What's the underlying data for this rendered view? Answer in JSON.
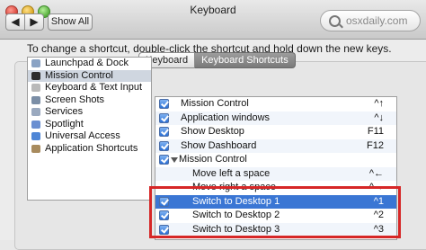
{
  "window": {
    "title": "Keyboard",
    "nav_back": "◀",
    "nav_forward": "▶",
    "show_all": "Show All",
    "watermark": "osxdaily.com"
  },
  "tabs": [
    {
      "label": "Keyboard",
      "selected": false
    },
    {
      "label": "Keyboard Shortcuts",
      "selected": true
    }
  ],
  "instructions": "To change a shortcut, double-click the shortcut and hold down the new keys.",
  "categories": [
    {
      "label": "Launchpad & Dock",
      "icon": "launchpad-icon",
      "color": "#8aa3c4"
    },
    {
      "label": "Mission Control",
      "icon": "mission-control-icon",
      "color": "#2d2d2d",
      "selected": true
    },
    {
      "label": "Keyboard & Text Input",
      "icon": "keyboard-icon",
      "color": "#b9b9b9"
    },
    {
      "label": "Screen Shots",
      "icon": "camera-icon",
      "color": "#7b8ea6"
    },
    {
      "label": "Services",
      "icon": "gear-icon",
      "color": "#9aa9bf"
    },
    {
      "label": "Spotlight",
      "icon": "spotlight-icon",
      "color": "#6b8fd1"
    },
    {
      "label": "Universal Access",
      "icon": "accessibility-icon",
      "color": "#4f86d6"
    },
    {
      "label": "Application Shortcuts",
      "icon": "app-icon",
      "color": "#a88b5e"
    }
  ],
  "shortcuts": [
    {
      "label": "Mission Control",
      "key": "^↑",
      "checked": true,
      "indent": 0
    },
    {
      "label": "Application windows",
      "key": "^↓",
      "checked": true,
      "indent": 0
    },
    {
      "label": "Show Desktop",
      "key": "F11",
      "checked": true,
      "indent": 0
    },
    {
      "label": "Show Dashboard",
      "key": "F12",
      "checked": true,
      "indent": 0
    },
    {
      "label": "Mission Control",
      "key": "",
      "checked": true,
      "indent": 0,
      "group": true
    },
    {
      "label": "Move left a space",
      "key": "^←",
      "checked": false,
      "indent": 1
    },
    {
      "label": "Move right a space",
      "key": "^→",
      "checked": false,
      "indent": 1
    },
    {
      "label": "Switch to Desktop 1",
      "key": "^1",
      "checked": true,
      "indent": 1,
      "highlight": true
    },
    {
      "label": "Switch to Desktop 2",
      "key": "^2",
      "checked": true,
      "indent": 1
    },
    {
      "label": "Switch to Desktop 3",
      "key": "^3",
      "checked": true,
      "indent": 1
    }
  ],
  "colors": {
    "selection": "#3a76d4",
    "annotation": "#d62727"
  }
}
